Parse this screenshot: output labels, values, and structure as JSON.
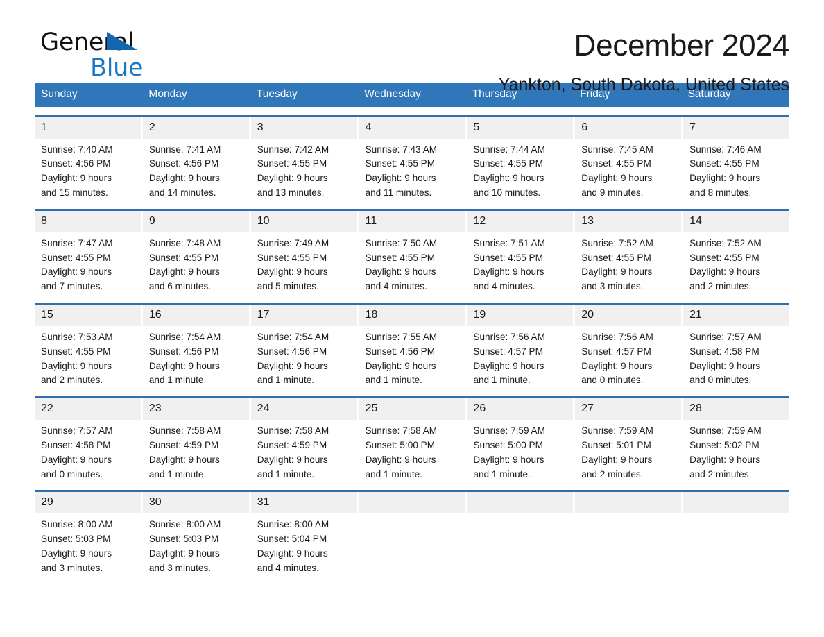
{
  "brand": {
    "word1": "General",
    "word2": "Blue",
    "triangle_color": "#1367ae",
    "word2_color": "#1878c8"
  },
  "header": {
    "title": "December 2024",
    "subtitle": "Yankton, South Dakota, United States"
  },
  "theme": {
    "header_blue": "#2f77b8",
    "row_rule_blue": "#2f6fab",
    "daynum_band": "#f0f0f0"
  },
  "weekdays": [
    "Sunday",
    "Monday",
    "Tuesday",
    "Wednesday",
    "Thursday",
    "Friday",
    "Saturday"
  ],
  "weeks": [
    [
      {
        "day": "1",
        "sunrise": "Sunrise: 7:40 AM",
        "sunset": "Sunset: 4:56 PM",
        "daylight1": "Daylight: 9 hours",
        "daylight2": "and 15 minutes."
      },
      {
        "day": "2",
        "sunrise": "Sunrise: 7:41 AM",
        "sunset": "Sunset: 4:56 PM",
        "daylight1": "Daylight: 9 hours",
        "daylight2": "and 14 minutes."
      },
      {
        "day": "3",
        "sunrise": "Sunrise: 7:42 AM",
        "sunset": "Sunset: 4:55 PM",
        "daylight1": "Daylight: 9 hours",
        "daylight2": "and 13 minutes."
      },
      {
        "day": "4",
        "sunrise": "Sunrise: 7:43 AM",
        "sunset": "Sunset: 4:55 PM",
        "daylight1": "Daylight: 9 hours",
        "daylight2": "and 11 minutes."
      },
      {
        "day": "5",
        "sunrise": "Sunrise: 7:44 AM",
        "sunset": "Sunset: 4:55 PM",
        "daylight1": "Daylight: 9 hours",
        "daylight2": "and 10 minutes."
      },
      {
        "day": "6",
        "sunrise": "Sunrise: 7:45 AM",
        "sunset": "Sunset: 4:55 PM",
        "daylight1": "Daylight: 9 hours",
        "daylight2": "and 9 minutes."
      },
      {
        "day": "7",
        "sunrise": "Sunrise: 7:46 AM",
        "sunset": "Sunset: 4:55 PM",
        "daylight1": "Daylight: 9 hours",
        "daylight2": "and 8 minutes."
      }
    ],
    [
      {
        "day": "8",
        "sunrise": "Sunrise: 7:47 AM",
        "sunset": "Sunset: 4:55 PM",
        "daylight1": "Daylight: 9 hours",
        "daylight2": "and 7 minutes."
      },
      {
        "day": "9",
        "sunrise": "Sunrise: 7:48 AM",
        "sunset": "Sunset: 4:55 PM",
        "daylight1": "Daylight: 9 hours",
        "daylight2": "and 6 minutes."
      },
      {
        "day": "10",
        "sunrise": "Sunrise: 7:49 AM",
        "sunset": "Sunset: 4:55 PM",
        "daylight1": "Daylight: 9 hours",
        "daylight2": "and 5 minutes."
      },
      {
        "day": "11",
        "sunrise": "Sunrise: 7:50 AM",
        "sunset": "Sunset: 4:55 PM",
        "daylight1": "Daylight: 9 hours",
        "daylight2": "and 4 minutes."
      },
      {
        "day": "12",
        "sunrise": "Sunrise: 7:51 AM",
        "sunset": "Sunset: 4:55 PM",
        "daylight1": "Daylight: 9 hours",
        "daylight2": "and 4 minutes."
      },
      {
        "day": "13",
        "sunrise": "Sunrise: 7:52 AM",
        "sunset": "Sunset: 4:55 PM",
        "daylight1": "Daylight: 9 hours",
        "daylight2": "and 3 minutes."
      },
      {
        "day": "14",
        "sunrise": "Sunrise: 7:52 AM",
        "sunset": "Sunset: 4:55 PM",
        "daylight1": "Daylight: 9 hours",
        "daylight2": "and 2 minutes."
      }
    ],
    [
      {
        "day": "15",
        "sunrise": "Sunrise: 7:53 AM",
        "sunset": "Sunset: 4:55 PM",
        "daylight1": "Daylight: 9 hours",
        "daylight2": "and 2 minutes."
      },
      {
        "day": "16",
        "sunrise": "Sunrise: 7:54 AM",
        "sunset": "Sunset: 4:56 PM",
        "daylight1": "Daylight: 9 hours",
        "daylight2": "and 1 minute."
      },
      {
        "day": "17",
        "sunrise": "Sunrise: 7:54 AM",
        "sunset": "Sunset: 4:56 PM",
        "daylight1": "Daylight: 9 hours",
        "daylight2": "and 1 minute."
      },
      {
        "day": "18",
        "sunrise": "Sunrise: 7:55 AM",
        "sunset": "Sunset: 4:56 PM",
        "daylight1": "Daylight: 9 hours",
        "daylight2": "and 1 minute."
      },
      {
        "day": "19",
        "sunrise": "Sunrise: 7:56 AM",
        "sunset": "Sunset: 4:57 PM",
        "daylight1": "Daylight: 9 hours",
        "daylight2": "and 1 minute."
      },
      {
        "day": "20",
        "sunrise": "Sunrise: 7:56 AM",
        "sunset": "Sunset: 4:57 PM",
        "daylight1": "Daylight: 9 hours",
        "daylight2": "and 0 minutes."
      },
      {
        "day": "21",
        "sunrise": "Sunrise: 7:57 AM",
        "sunset": "Sunset: 4:58 PM",
        "daylight1": "Daylight: 9 hours",
        "daylight2": "and 0 minutes."
      }
    ],
    [
      {
        "day": "22",
        "sunrise": "Sunrise: 7:57 AM",
        "sunset": "Sunset: 4:58 PM",
        "daylight1": "Daylight: 9 hours",
        "daylight2": "and 0 minutes."
      },
      {
        "day": "23",
        "sunrise": "Sunrise: 7:58 AM",
        "sunset": "Sunset: 4:59 PM",
        "daylight1": "Daylight: 9 hours",
        "daylight2": "and 1 minute."
      },
      {
        "day": "24",
        "sunrise": "Sunrise: 7:58 AM",
        "sunset": "Sunset: 4:59 PM",
        "daylight1": "Daylight: 9 hours",
        "daylight2": "and 1 minute."
      },
      {
        "day": "25",
        "sunrise": "Sunrise: 7:58 AM",
        "sunset": "Sunset: 5:00 PM",
        "daylight1": "Daylight: 9 hours",
        "daylight2": "and 1 minute."
      },
      {
        "day": "26",
        "sunrise": "Sunrise: 7:59 AM",
        "sunset": "Sunset: 5:00 PM",
        "daylight1": "Daylight: 9 hours",
        "daylight2": "and 1 minute."
      },
      {
        "day": "27",
        "sunrise": "Sunrise: 7:59 AM",
        "sunset": "Sunset: 5:01 PM",
        "daylight1": "Daylight: 9 hours",
        "daylight2": "and 2 minutes."
      },
      {
        "day": "28",
        "sunrise": "Sunrise: 7:59 AM",
        "sunset": "Sunset: 5:02 PM",
        "daylight1": "Daylight: 9 hours",
        "daylight2": "and 2 minutes."
      }
    ],
    [
      {
        "day": "29",
        "sunrise": "Sunrise: 8:00 AM",
        "sunset": "Sunset: 5:03 PM",
        "daylight1": "Daylight: 9 hours",
        "daylight2": "and 3 minutes."
      },
      {
        "day": "30",
        "sunrise": "Sunrise: 8:00 AM",
        "sunset": "Sunset: 5:03 PM",
        "daylight1": "Daylight: 9 hours",
        "daylight2": "and 3 minutes."
      },
      {
        "day": "31",
        "sunrise": "Sunrise: 8:00 AM",
        "sunset": "Sunset: 5:04 PM",
        "daylight1": "Daylight: 9 hours",
        "daylight2": "and 4 minutes."
      },
      {
        "day": "",
        "sunrise": "",
        "sunset": "",
        "daylight1": "",
        "daylight2": ""
      },
      {
        "day": "",
        "sunrise": "",
        "sunset": "",
        "daylight1": "",
        "daylight2": ""
      },
      {
        "day": "",
        "sunrise": "",
        "sunset": "",
        "daylight1": "",
        "daylight2": ""
      },
      {
        "day": "",
        "sunrise": "",
        "sunset": "",
        "daylight1": "",
        "daylight2": ""
      }
    ]
  ]
}
